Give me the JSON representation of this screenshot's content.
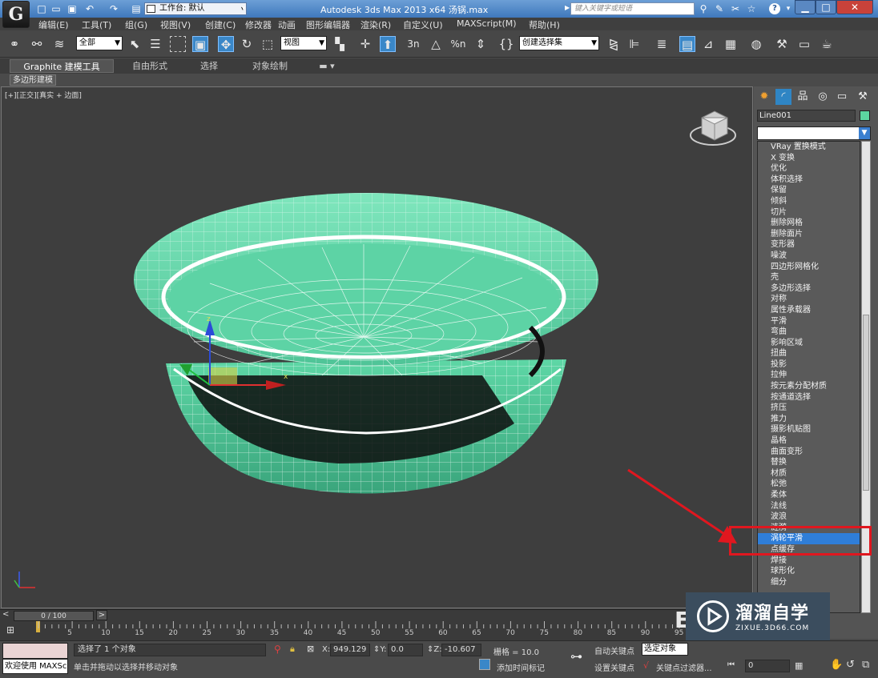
{
  "window": {
    "app_icon_glyph": "G",
    "workspace_label": "工作台: 默认",
    "title": "Autodesk 3ds Max  2013 x64      汤锅.max",
    "search_placeholder": "键入关键字或短语",
    "help_label": "?"
  },
  "menu": [
    "编辑(E)",
    "工具(T)",
    "组(G)",
    "视图(V)",
    "创建(C)",
    "修改器",
    "动画",
    "图形编辑器",
    "渲染(R)",
    "自定义(U)",
    "MAXScript(M)",
    "帮助(H)"
  ],
  "toolbar": {
    "selection_filter": "全部",
    "reference_coord": "视图",
    "snap_labels": [
      "3",
      "%",
      "%"
    ],
    "named_selection": "创建选择集"
  },
  "ribbon": {
    "tabs": [
      "Graphite 建模工具",
      "自由形式",
      "选择",
      "对象绘制"
    ],
    "subtab": "多边形建模"
  },
  "viewport": {
    "label": "[+][正交][真实 + 边面]",
    "gizmo_x": "x",
    "gizmo_z": "z",
    "mesh_color": "#5ed7a6"
  },
  "command_panel": {
    "object_name": "Line001",
    "object_color": "#5cd6a0",
    "modifiers": [
      "VRay 置换模式",
      "X 变换",
      "优化",
      "体积选择",
      "保留",
      "倾斜",
      "切片",
      "删除网格",
      "删除面片",
      "变形器",
      "噪波",
      "四边形网格化",
      "壳",
      "多边形选择",
      "对称",
      "属性承载器",
      "平滑",
      "弯曲",
      "影响区域",
      "扭曲",
      "投影",
      "拉伸",
      "按元素分配材质",
      "按通道选择",
      "挤压",
      "推力",
      "摄影机贴图",
      "晶格",
      "曲面变形",
      "替换",
      "材质",
      "松弛",
      "柔体",
      "法线",
      "波浪",
      "涟漪",
      "涡轮平滑",
      "点缓存",
      "焊接",
      "球形化",
      "细分"
    ],
    "selected_modifier": "涡轮平滑"
  },
  "timeline": {
    "slider_label": "0 / 100",
    "ticks": [
      "5",
      "10",
      "15",
      "20",
      "25",
      "30",
      "35",
      "40",
      "45",
      "50",
      "55",
      "60",
      "65",
      "70",
      "75",
      "80",
      "85",
      "90",
      "95"
    ]
  },
  "status": {
    "welcome": "欢迎使用 MAXSc",
    "selection_info": "选择了 1 个对象",
    "prompt": "单击并拖动以选择并移动对象",
    "x_value": "949.129",
    "y_value": "0.0",
    "z_value": "-10.607",
    "grid": "栅格 = 10.0",
    "auto_key": "自动关键点",
    "selected_object": "选定对象",
    "set_key": "设置关键点",
    "key_filter": "关键点过滤器...",
    "add_time_tag": "添加时间标记",
    "frame": "0"
  },
  "watermark": {
    "cn": "溜溜自学",
    "en": "ZIXUE.3D66.COM"
  }
}
